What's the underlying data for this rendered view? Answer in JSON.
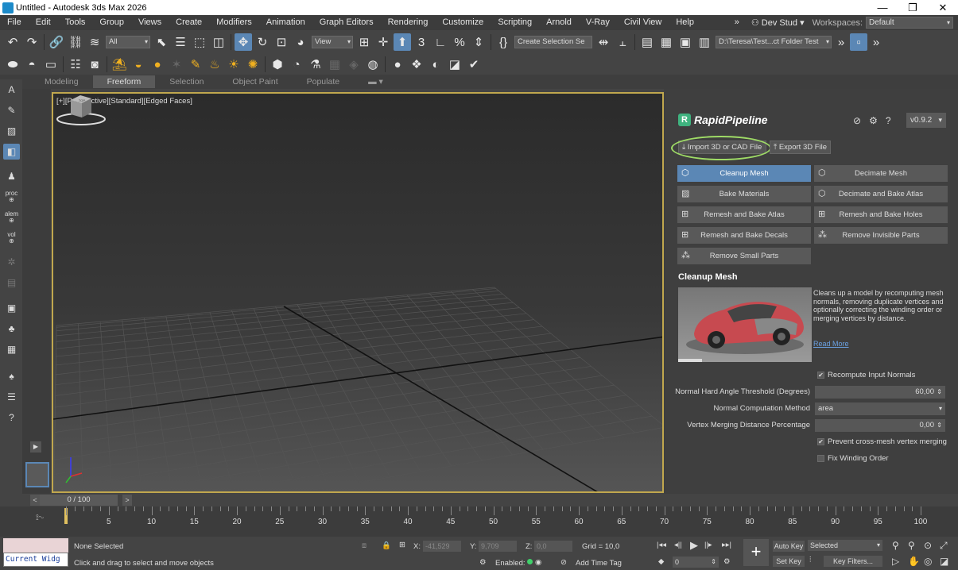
{
  "window": {
    "title": "Untitled - Autodesk 3ds Max 2026",
    "minimize": "—",
    "maximize": "❐",
    "close": "✕"
  },
  "menu": {
    "items": [
      "File",
      "Edit",
      "Tools",
      "Group",
      "Views",
      "Create",
      "Modifiers",
      "Animation",
      "Graph Editors",
      "Rendering",
      "Customize",
      "Scripting",
      "Arnold",
      "V-Ray",
      "Civil View",
      "Help"
    ],
    "overflow": "»",
    "user": "Dev Stud",
    "workspaces_label": "Workspaces:",
    "workspace": "Default"
  },
  "toolbar": {
    "filter": "All",
    "view": "View",
    "selection_set": "Create Selection Se",
    "project_path": "D:\\Teresa\\Test...ct Folder Test"
  },
  "ribbon": {
    "tabs": [
      "Modeling",
      "Freeform",
      "Selection",
      "Object Paint",
      "Populate"
    ],
    "active": "Freeform"
  },
  "left_toolbar": {
    "labels": [
      "proc",
      "alem",
      "vol"
    ]
  },
  "viewport": {
    "label": "[+][Perspective][Standard][Edged Faces]",
    "viewcube_label": "TOP"
  },
  "plugin": {
    "name": "RapidPipeline",
    "version": "v0.9.2",
    "import_label": "Import 3D or CAD File",
    "export_label": "Export 3D File",
    "functions": [
      "Cleanup Mesh",
      "Decimate Mesh",
      "Bake Materials",
      "Decimate and Bake Atlas",
      "Remesh and Bake Atlas",
      "Remesh and Bake Holes",
      "Remesh and Bake Decals",
      "Remove Invisible Parts",
      "Remove Small Parts"
    ],
    "active_function": "Cleanup Mesh",
    "section_title": "Cleanup Mesh",
    "description": "Cleans up a model by recomputing mesh normals, removing duplicate vertices and optionally correcting the winding order or merging vertices by distance.",
    "read_more": "Read More",
    "recompute_normals": {
      "label": "Recompute Input Normals",
      "checked": true
    },
    "hard_angle": {
      "label": "Normal Hard Angle Threshold (Degrees)",
      "value": "60,00"
    },
    "normal_method": {
      "label": "Normal Computation Method",
      "value": "area"
    },
    "merge_distance": {
      "label": "Vertex Merging Distance Percentage",
      "value": "0,00"
    },
    "prevent_cross": {
      "label": "Prevent cross-mesh vertex merging",
      "checked": true
    },
    "fix_winding": {
      "label": "Fix Winding Order",
      "checked": false
    }
  },
  "timeline": {
    "frame": "0 / 100",
    "ticks": [
      "0",
      "5",
      "10",
      "15",
      "20",
      "25",
      "30",
      "35",
      "40",
      "45",
      "50",
      "55",
      "60",
      "65",
      "70",
      "75",
      "80",
      "85",
      "90",
      "95",
      "100"
    ]
  },
  "status": {
    "current_widget": "Current Widg",
    "selection": "None Selected",
    "hint": "Click and drag to select and move objects",
    "x_label": "X:",
    "x": "-41,529",
    "y_label": "Y:",
    "y": "9,709",
    "z_label": "Z:",
    "z": "0,0",
    "grid": "Grid = 10,0",
    "enabled": "Enabled:",
    "add_time_tag": "Add Time Tag",
    "auto_key": "Auto Key",
    "set_key": "Set Key",
    "selected": "Selected",
    "key_filters": "Key Filters...",
    "frame_field": "0"
  },
  "colors": {
    "accent": "#5b87b5",
    "highlight_ring": "#9fdc66",
    "viewport_border": "#c0a74e",
    "brand_green": "#3fb37f"
  }
}
